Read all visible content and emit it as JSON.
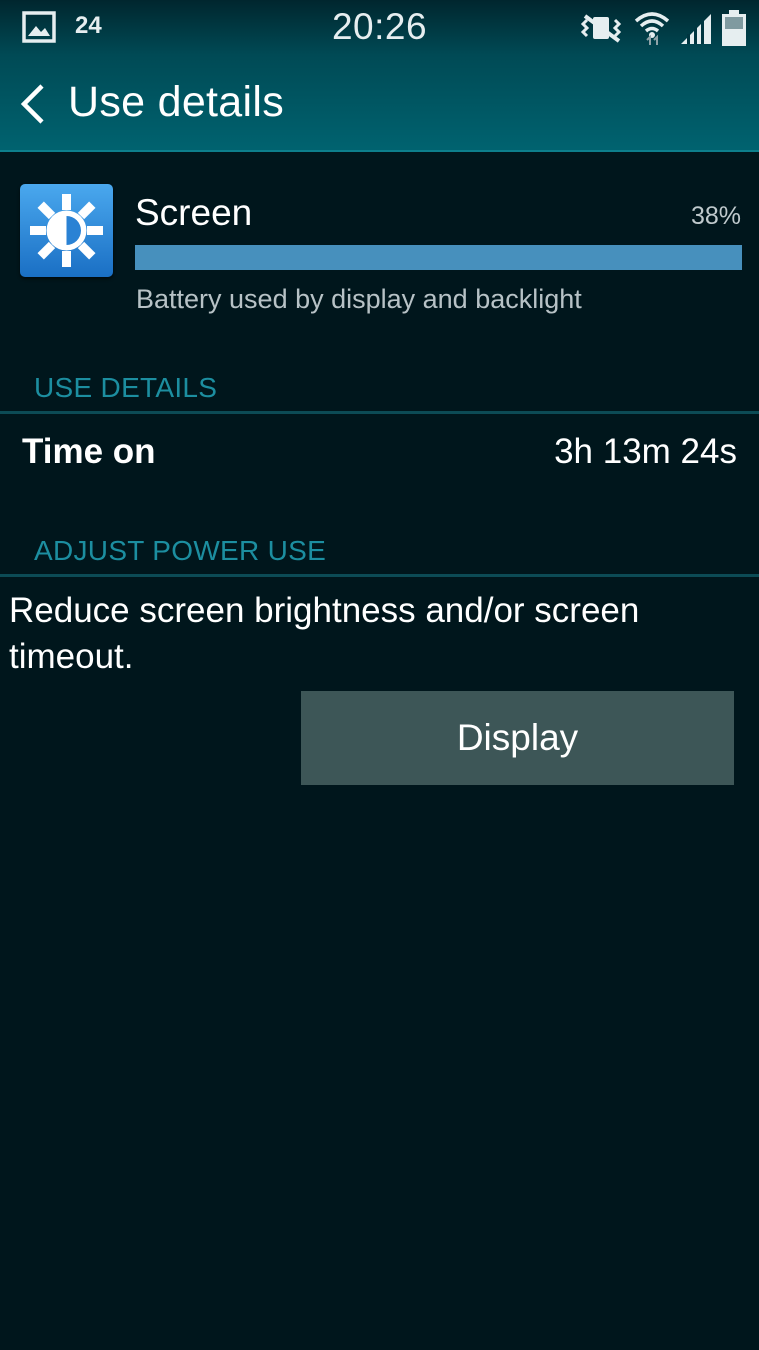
{
  "status_bar": {
    "notification_count": "24",
    "time": "20:26",
    "icons": [
      "gallery-notification-icon",
      "vibrate-mode-icon",
      "wifi-icon",
      "signal-icon",
      "battery-icon"
    ]
  },
  "header": {
    "title": "Use details",
    "back_icon": "chevron-left-icon"
  },
  "usage": {
    "name": "Screen",
    "percent_label": "38%",
    "percent_value": 38,
    "description": "Battery used by display and backlight",
    "icon": "screen-brightness-icon"
  },
  "sections": {
    "use_details": "USE DETAILS",
    "adjust_power_use": "ADJUST POWER USE"
  },
  "time_on": {
    "label": "Time on",
    "value": "3h 13m 24s"
  },
  "advice": {
    "text": "Reduce screen brightness and/or screen timeout.",
    "button_label": "Display"
  },
  "colors": {
    "background": "#00161c",
    "accent": "#1c8ea0",
    "bar_fill": "#4790bd",
    "button": "#3d5657"
  }
}
